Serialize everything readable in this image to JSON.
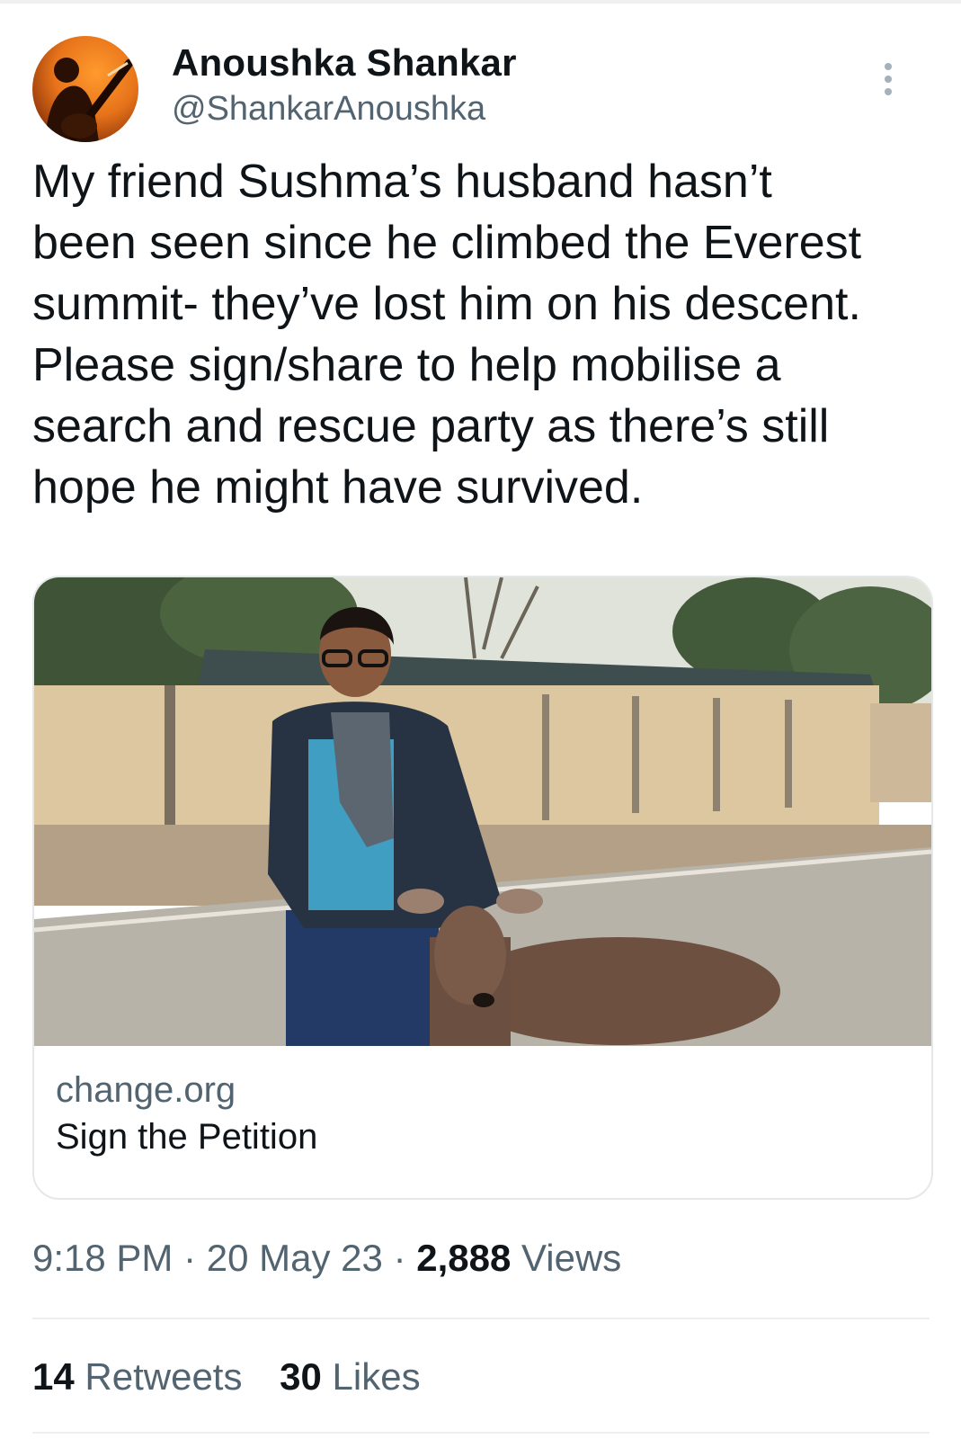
{
  "author": {
    "name": "Anoushka Shankar",
    "handle": "@ShankarAnoushka"
  },
  "tweet": {
    "text": "My friend Sushma’s husband hasn’t\nbeen seen since he climbed the Everest\nsummit- they’ve lost him on his descent.\nPlease sign/share to help mobilise a\nsearch and rescue party as there’s still\nhope he might have survived."
  },
  "link_card": {
    "domain": "change.org",
    "title": "Sign the Petition"
  },
  "meta": {
    "time": "9:18 PM",
    "separator": "·",
    "date": "20 May 23",
    "views_count": "2,888",
    "views_label": "Views"
  },
  "stats": {
    "retweets_count": "14",
    "retweets_label": "Retweets",
    "likes_count": "30",
    "likes_label": "Likes"
  },
  "colors": {
    "text_primary": "#0f1419",
    "text_secondary": "#536471",
    "border": "#e4e8eb",
    "avatar_orange": "#e7731a"
  },
  "icons": {
    "more": "more-vertical-icon"
  }
}
